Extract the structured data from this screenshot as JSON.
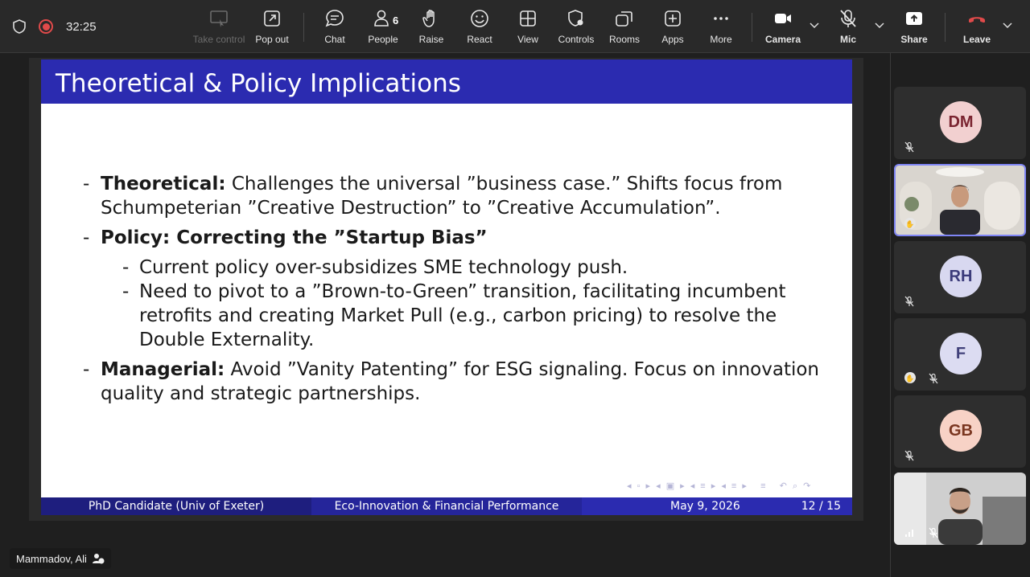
{
  "meeting": {
    "timer": "32:25"
  },
  "toolbar": {
    "take_control": "Take control",
    "pop_out": "Pop out",
    "chat": "Chat",
    "people": "People",
    "people_count": "6",
    "raise": "Raise",
    "react": "React",
    "view": "View",
    "controls": "Controls",
    "rooms": "Rooms",
    "apps": "Apps",
    "more": "More",
    "camera": "Camera",
    "mic": "Mic",
    "share": "Share",
    "leave": "Leave"
  },
  "slide": {
    "title": "Theoretical & Policy Implications",
    "b1_label": "Theoretical:",
    "b1_line1": " Challenges the universal ”business case.” Shifts focus from",
    "b1_line2": "Schumpeterian ”Creative Destruction” to ”Creative Accumulation”.",
    "b2_label": "Policy:  Correcting the ”Startup Bias”",
    "s1": "Current policy over-subsidizes SME technology push.",
    "s2_line1": "Need to pivot to a ”Brown-to-Green” transition, facilitating incumbent",
    "s2_line2": "retrofits and creating Market Pull (e.g., carbon pricing) to resolve the",
    "s2_line3": "Double Externality.",
    "b3_label": "Managerial:",
    "b3_line1": " Avoid ”Vanity Patenting” for ESG signaling.  Focus on innovation",
    "b3_line2": "quality and strategic partnerships.",
    "footer_author": "PhD Candidate  (Univ of Exeter)",
    "footer_topic": "Eco-Innovation & Financial Performance",
    "footer_date": "May 9, 2026",
    "footer_page": "12 / 15"
  },
  "participants": [
    {
      "initials": "DM",
      "bg": "#f2d0d0",
      "fg": "#7a2430"
    },
    {
      "initials": "",
      "video": true
    },
    {
      "initials": "RH",
      "bg": "#d8d8f0",
      "fg": "#3b3b7a"
    },
    {
      "initials": "F",
      "bg": "#dcdcf2",
      "fg": "#40407a"
    },
    {
      "initials": "GB",
      "bg": "#f7d2c6",
      "fg": "#7a3620"
    },
    {
      "initials": "",
      "video": true
    }
  ],
  "presenter": {
    "name": "Mammadov, Ali"
  },
  "colors": {
    "slide_header": "#2b2bb0",
    "leave_red": "#e04a4a",
    "active_border": "#7f85f5"
  }
}
